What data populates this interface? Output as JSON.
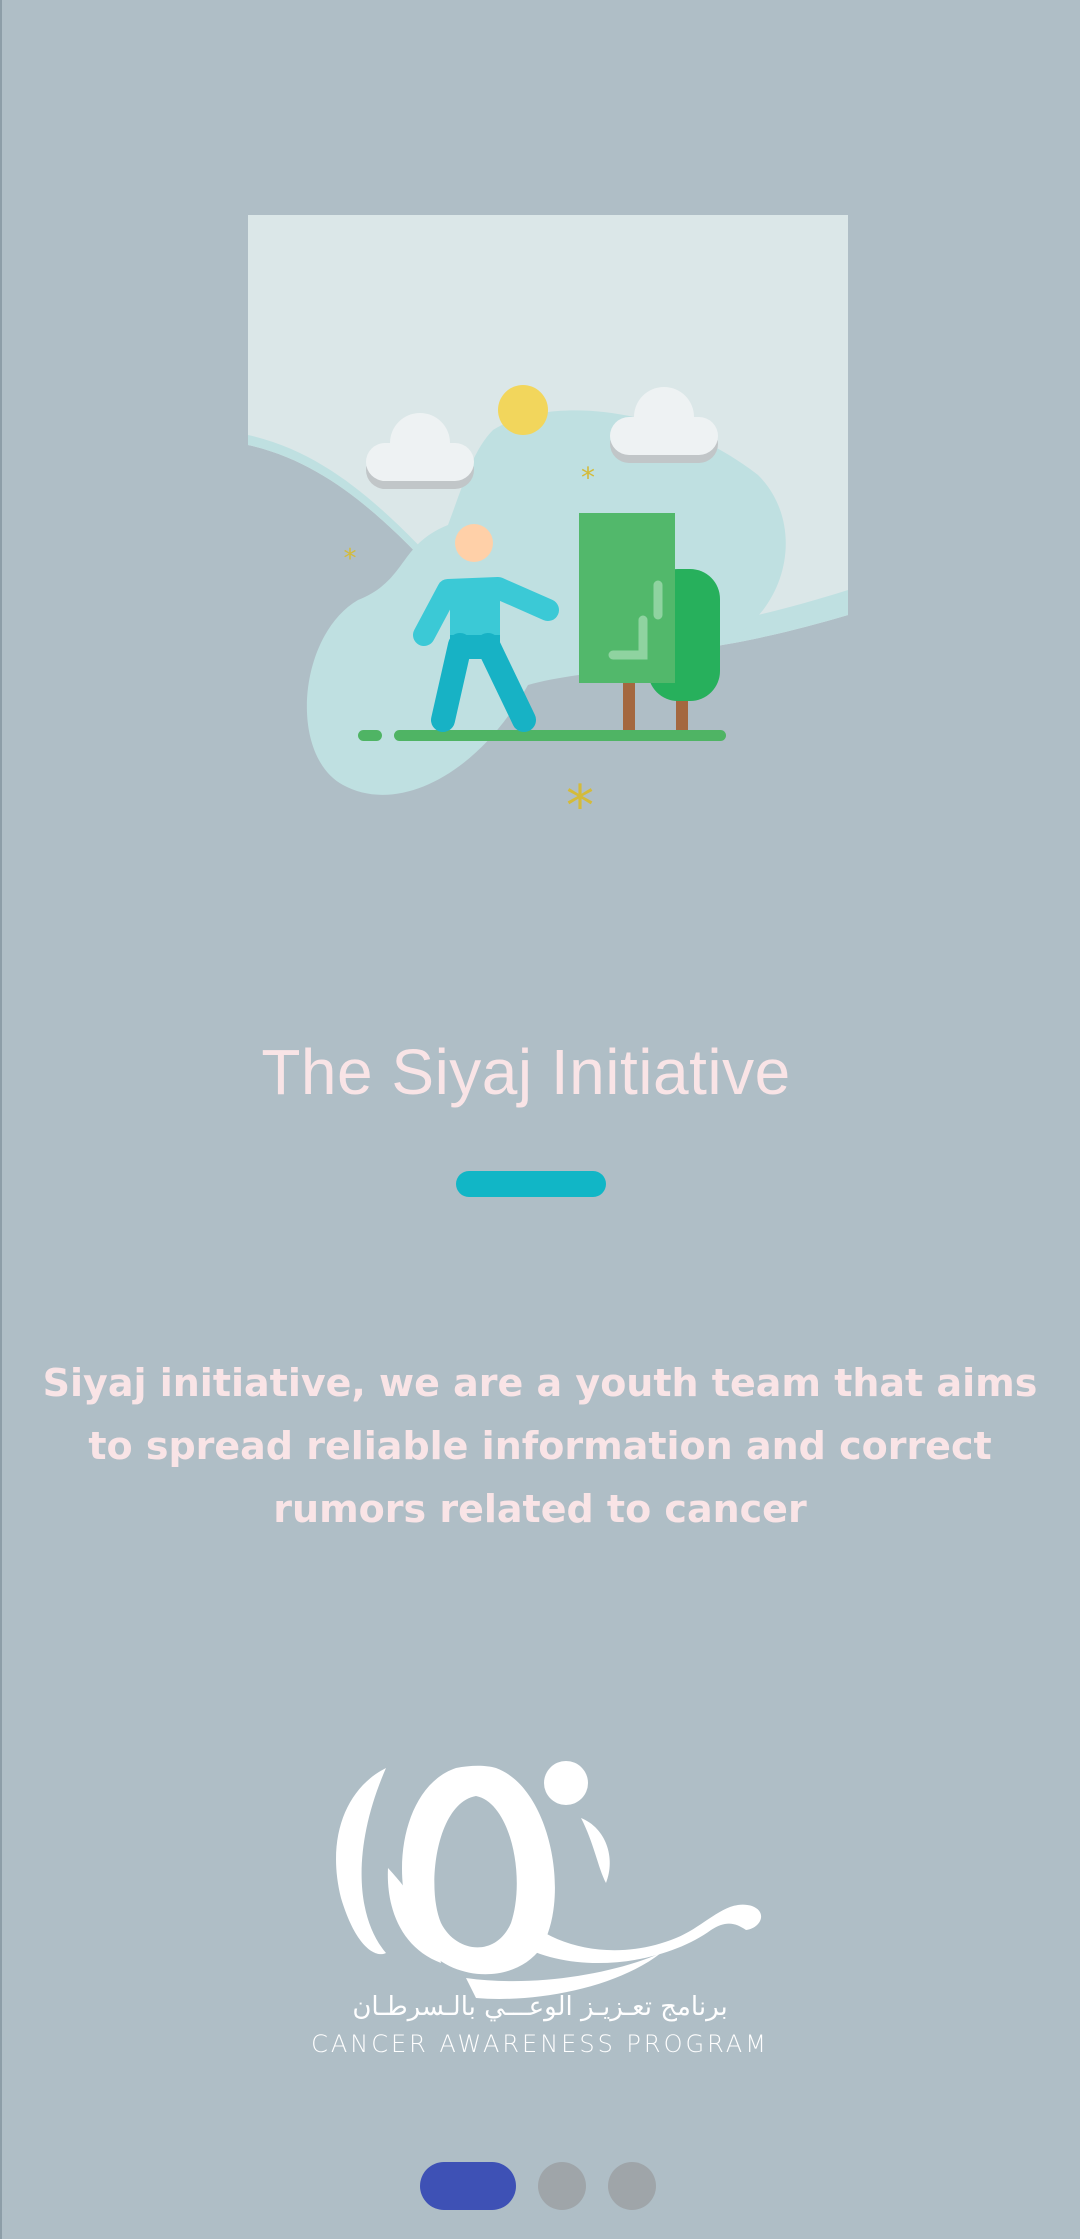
{
  "onboarding": {
    "title": "The Siyaj Initiative",
    "description": "Siyaj initiative,  we are a youth team that aims to spread reliable information and correct rumors related to cancer"
  },
  "logo": {
    "arabic_text": "برنامج تعـزيـز الوعـــي بالـسرطـان",
    "english_text": "CANCER AWARENESS PROGRAM"
  },
  "pager": {
    "pages": 3,
    "active_index": 0
  },
  "colors": {
    "background": "#afbec6",
    "title_text": "#f9e4e6",
    "accent_underline": "#11b6c6",
    "active_dot": "#3e51b5",
    "inactive_dot": "#9fa5a9"
  },
  "icons": [
    "walking-person-illustration",
    "siyaj-logo"
  ]
}
